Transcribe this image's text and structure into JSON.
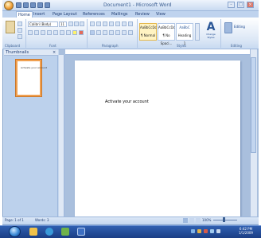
{
  "window": {
    "title": "Document1 - Microsoft Word",
    "minimize": "–",
    "maximize": "□",
    "close": "×"
  },
  "tabs": [
    "Home",
    "Insert",
    "Page Layout",
    "References",
    "Mailings",
    "Review",
    "View"
  ],
  "ribbon": {
    "font_name": "Calibri (Body)",
    "font_size": "11",
    "groups": [
      "Clipboard",
      "Font",
      "Paragraph",
      "Styles",
      "Editing"
    ],
    "styles": [
      "AaBbCcDc",
      "AaBbCcDc",
      "AaBbC"
    ],
    "style_names": [
      "¶ Normal",
      "¶ No Spaci...",
      "Heading 1"
    ],
    "change_styles": "Change Styles",
    "editing": "Editing"
  },
  "nav_pane": {
    "title": "Thumbnails",
    "close": "×",
    "thumb_text": "Activate your account"
  },
  "document": {
    "body_text": "Activate your account"
  },
  "statusbar": {
    "page": "Page: 1 of 1",
    "words": "Words: 3",
    "zoom": "100%"
  },
  "taskbar": {
    "time": "6:42 PM",
    "date": "1/1/2009"
  }
}
